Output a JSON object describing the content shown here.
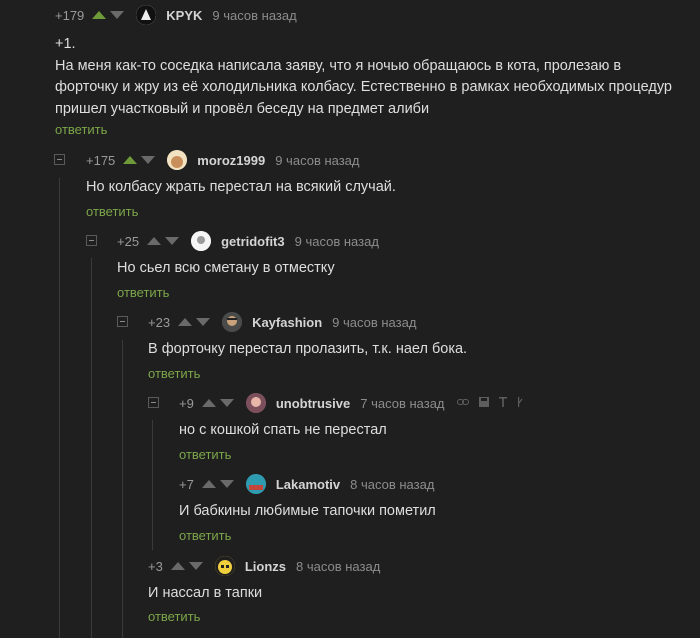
{
  "reply_label": "ответить",
  "comments": [
    {
      "rating": "+179",
      "nick": "KPYK",
      "time": "9 часов назад",
      "text": "+1.\nНа меня как-то соседка написала заяву, что я ночью обращаюсь в кота, пролезаю в форточку и жру из её холодильника колбасу. Естественно в рамках необходимых процедур пришел участковый и провёл беседу на предмет алиби",
      "upvoted": true
    },
    {
      "rating": "+175",
      "nick": "moroz1999",
      "time": "9 часов назад",
      "text": "Но колбасу жрать перестал на всякий случай.",
      "upvoted": true
    },
    {
      "rating": "+25",
      "nick": "getridofit3",
      "time": "9 часов назад",
      "text": "Но сьел всю сметану в отместку",
      "upvoted": false
    },
    {
      "rating": "+23",
      "nick": "Kayfashion",
      "time": "9 часов назад",
      "text": "В форточку перестал пролазить, т.к. наел бока.",
      "upvoted": false
    },
    {
      "rating": "+9",
      "nick": "unobtrusive",
      "time": "7 часов назад",
      "text": "но с кошкой спать не перестал",
      "upvoted": false
    },
    {
      "rating": "+7",
      "nick": "Lakamotiv",
      "time": "8 часов назад",
      "text": "И бабкины любимые тапочки пометил",
      "upvoted": false
    },
    {
      "rating": "+3",
      "nick": "Lionzs",
      "time": "8 часов назад",
      "text": "И нассал в тапки",
      "upvoted": false
    }
  ],
  "colors": {
    "background": "#1f1f1f",
    "reply_link": "#7ca64a",
    "upvote_active": "#6e9a3a",
    "text": "#dedede"
  }
}
